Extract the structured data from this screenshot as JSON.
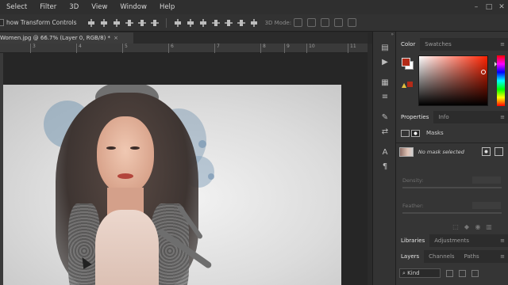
{
  "menubar": {
    "items": [
      "Select",
      "Filter",
      "3D",
      "View",
      "Window",
      "Help"
    ],
    "window_controls": [
      "–",
      "□",
      "✕"
    ]
  },
  "options": {
    "show_transform_label": "how Transform Controls",
    "mode_3d_label": "3D Mode:"
  },
  "document": {
    "tab_title": "Women.jpg @ 66.7% (Layer 0, RGB/8) *",
    "close_symbol": "×"
  },
  "ruler": {
    "ticks": [
      "3",
      "4",
      "5",
      "6",
      "7",
      "8",
      "9",
      "10",
      "11"
    ]
  },
  "color_panel": {
    "tabs": [
      "Color",
      "Swatches"
    ],
    "foreground": "#b42b18",
    "background": "#ffffff",
    "warning_icon": "warning-triangle-icon"
  },
  "properties_panel": {
    "tabs": [
      "Properties",
      "Info"
    ],
    "section_label": "Masks",
    "no_mask_text": "No mask selected",
    "density_label": "Density:",
    "feather_label": "Feather:"
  },
  "libraries_panel": {
    "tabs": [
      "Libraries",
      "Adjustments"
    ]
  },
  "layers_panel": {
    "tabs": [
      "Layers",
      "Channels",
      "Paths"
    ],
    "filter_kind": "Kind"
  },
  "dock": {
    "icons": [
      "history-icon",
      "play-icon",
      "properties-icon",
      "paragraph-styles-icon",
      "brush-icon",
      "adjust-icon",
      "character-icon",
      "paragraph-icon"
    ]
  }
}
